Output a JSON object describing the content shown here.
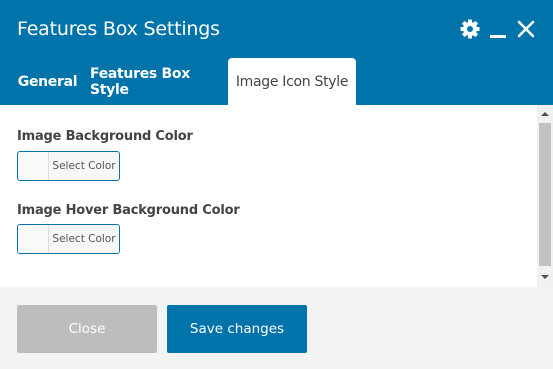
{
  "dialog": {
    "title": "Features Box Settings"
  },
  "header_icons": [
    "gear-icon",
    "minimize-icon",
    "close-icon"
  ],
  "tabs": [
    {
      "label": "General",
      "active": false
    },
    {
      "label": "Features Box Style",
      "active": false
    },
    {
      "label": "Image Icon Style",
      "active": true
    }
  ],
  "fields": [
    {
      "label": "Image Background Color",
      "button_text": "Select Color"
    },
    {
      "label": "Image Hover Background Color",
      "button_text": "Select Color"
    }
  ],
  "footer": {
    "close_label": "Close",
    "save_label": "Save changes"
  },
  "colors": {
    "primary": "#0073aa",
    "disabled_button": "#bdbdbd",
    "footer_bg": "#f3f3f3"
  }
}
